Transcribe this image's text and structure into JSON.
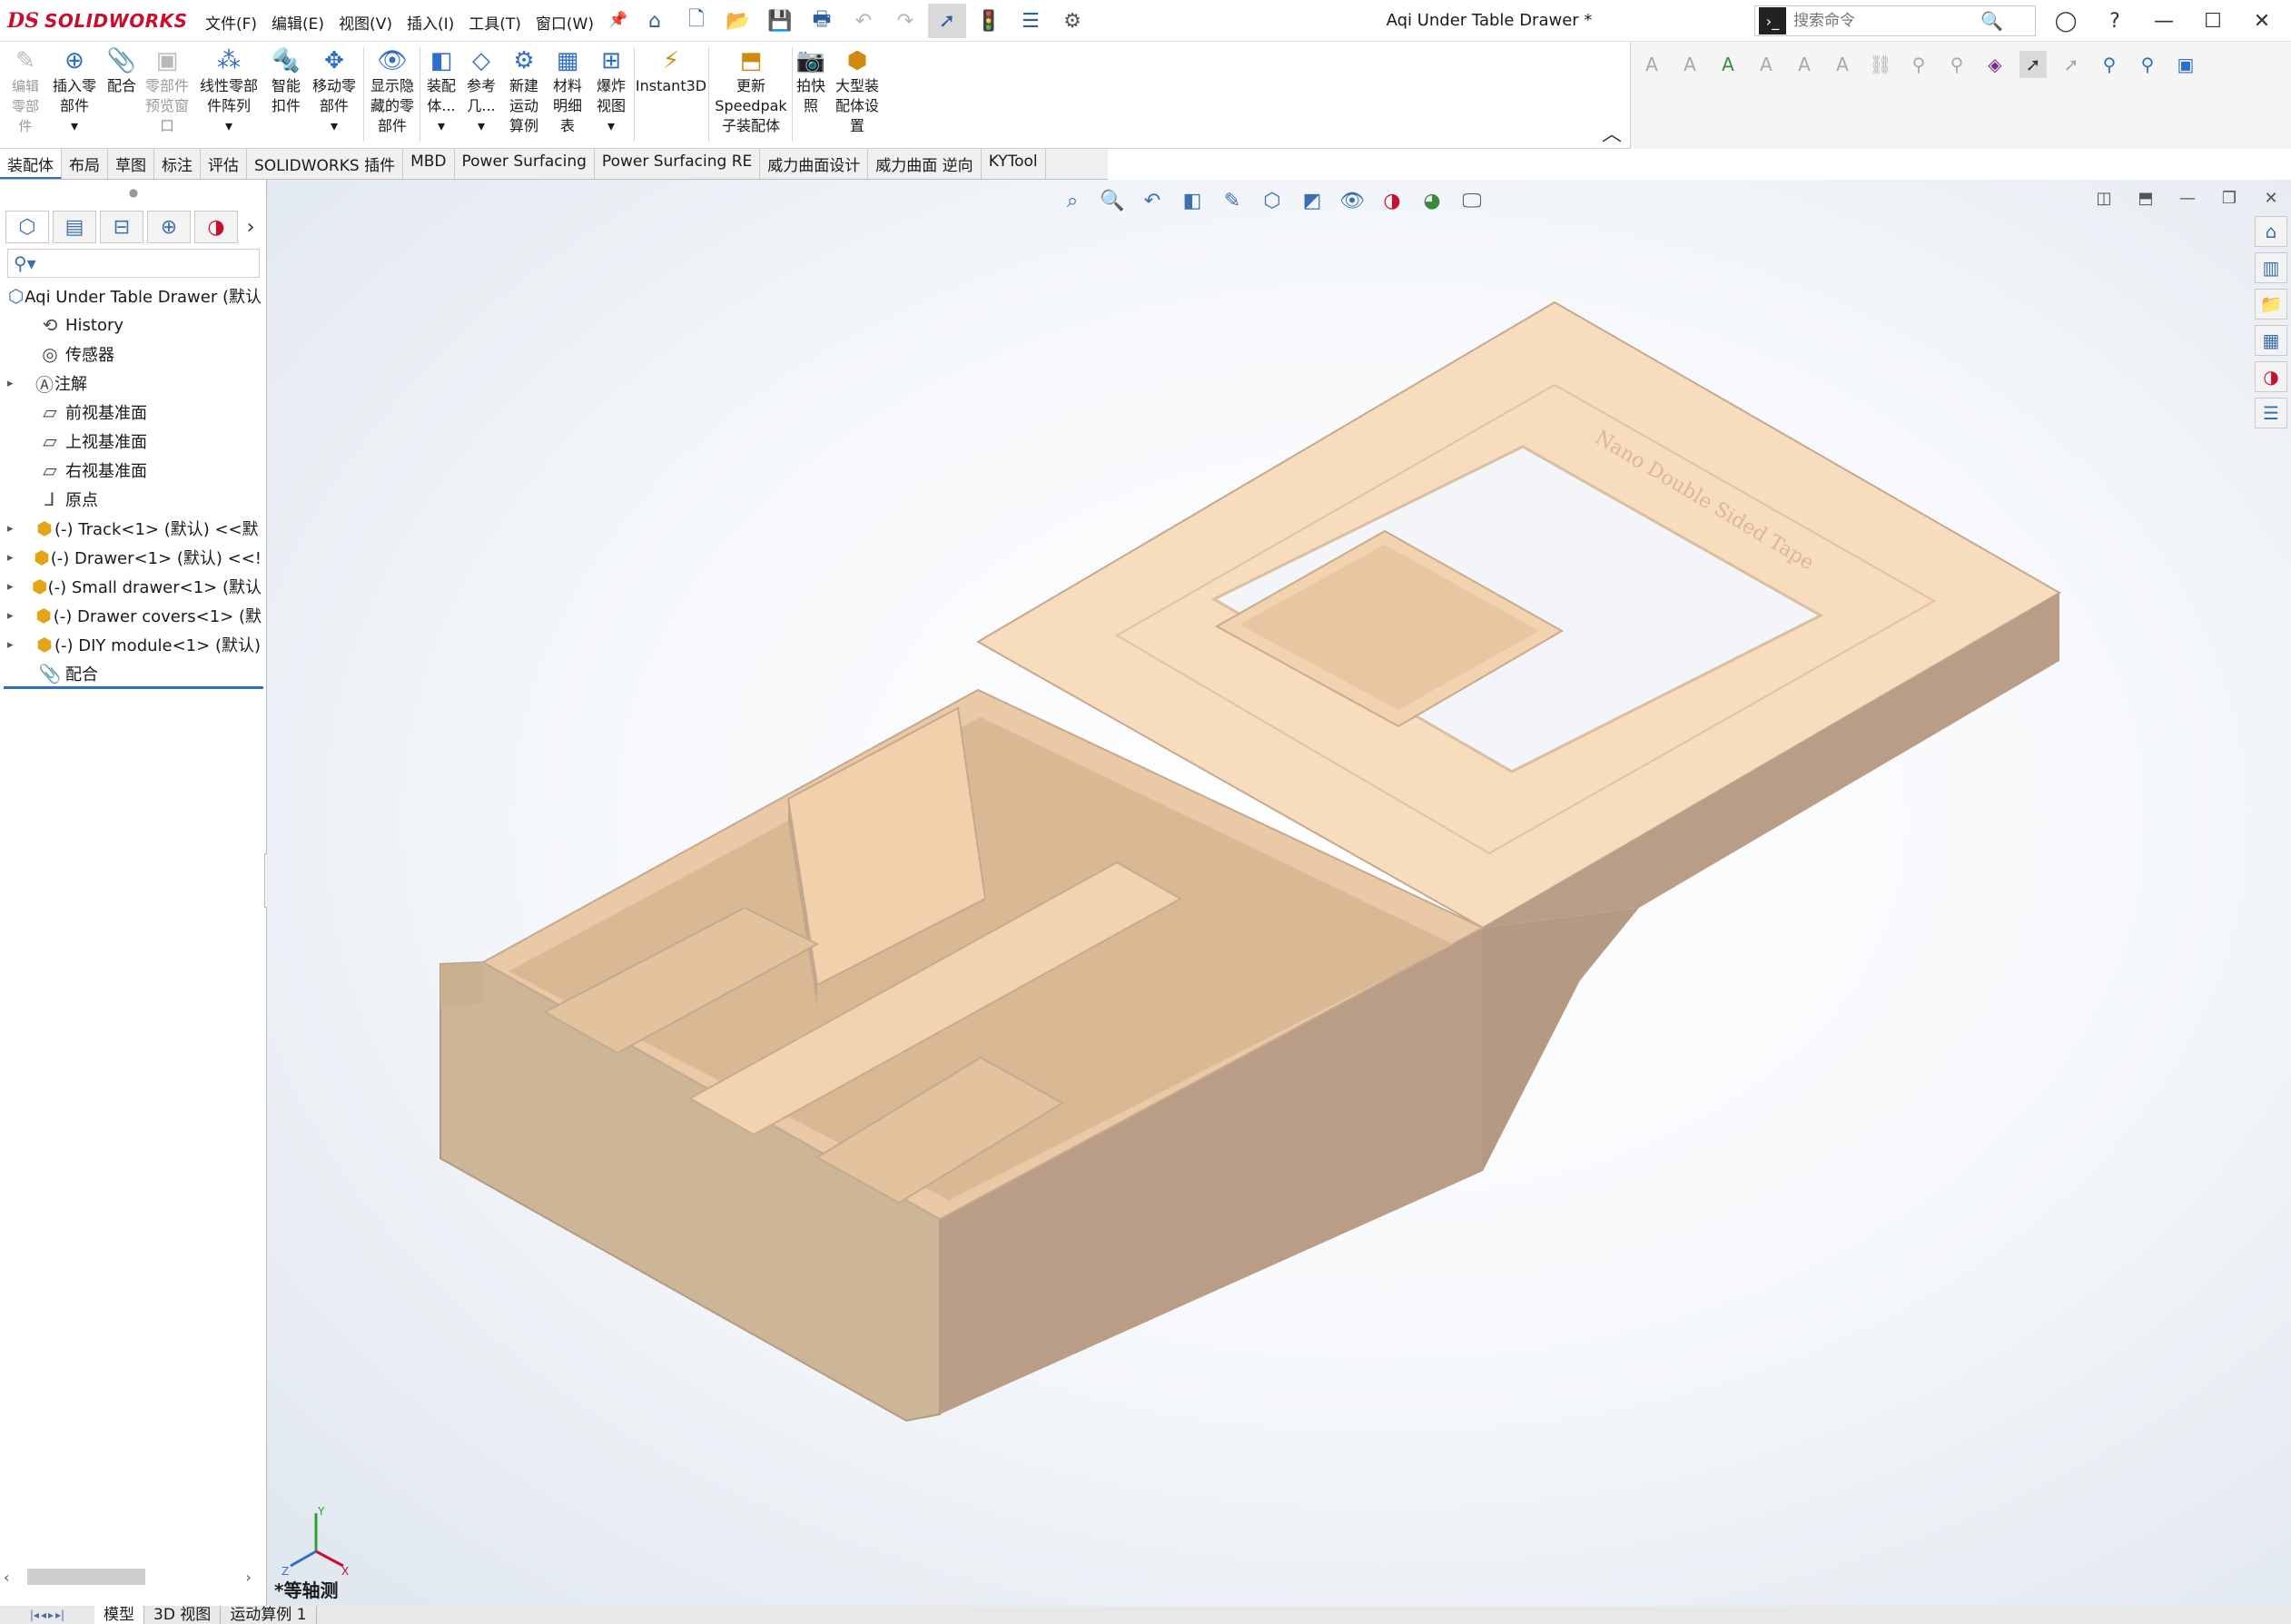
{
  "app": {
    "logo_mark": "DS",
    "logo_text": "SOLIDWORKS",
    "document_title": "Aqi Under Table Drawer *"
  },
  "menu": [
    "文件(F)",
    "编辑(E)",
    "视图(V)",
    "插入(I)",
    "工具(T)",
    "窗口(W)"
  ],
  "search": {
    "placeholder": "搜索命令"
  },
  "ribbon": {
    "buttons": [
      {
        "name": "edit-component",
        "label": "编辑\n零部\n件",
        "icon": "edit-component-icon",
        "disabled": true
      },
      {
        "name": "insert-components",
        "label": "插入零\n部件",
        "icon": "insert-component-icon"
      },
      {
        "name": "mate",
        "label": "配合",
        "icon": "mate-icon"
      },
      {
        "name": "component-preview",
        "label": "零部件\n预览窗\n口",
        "icon": "preview-window-icon",
        "disabled": true
      },
      {
        "name": "linear-pattern",
        "label": "线性零部\n件阵列",
        "icon": "linear-pattern-icon"
      },
      {
        "name": "smart-fasteners",
        "label": "智能\n扣件",
        "icon": "smart-fastener-icon"
      },
      {
        "name": "move-component",
        "label": "移动零\n部件",
        "icon": "move-component-icon"
      },
      {
        "name": "show-hidden",
        "label": "显示隐\n藏的零\n部件",
        "icon": "show-hidden-icon"
      },
      {
        "name": "assembly-features",
        "label": "装配\n体...",
        "icon": "assembly-feature-icon"
      },
      {
        "name": "reference-geometry",
        "label": "参考\n几...",
        "icon": "reference-geometry-icon"
      },
      {
        "name": "new-motion-study",
        "label": "新建\n运动\n算例",
        "icon": "motion-study-icon"
      },
      {
        "name": "bill-of-materials",
        "label": "材料\n明细\n表",
        "icon": "bom-icon"
      },
      {
        "name": "exploded-view",
        "label": "爆炸\n视图",
        "icon": "exploded-view-icon"
      },
      {
        "name": "instant3d",
        "label": "Instant3D",
        "icon": "instant3d-icon"
      },
      {
        "name": "update-speedpak",
        "label": "更新\nSpeedpak\n子装配体",
        "icon": "speedpak-icon"
      },
      {
        "name": "take-snapshot",
        "label": "拍快\n照",
        "icon": "camera-icon"
      },
      {
        "name": "large-assembly-settings",
        "label": "大型装\n配体设\n置",
        "icon": "large-assembly-icon"
      }
    ]
  },
  "tabs": [
    "装配体",
    "布局",
    "草图",
    "标注",
    "评估",
    "SOLIDWORKS 插件",
    "MBD",
    "Power Surfacing",
    "Power Surfacing RE",
    "威力曲面设计",
    "威力曲面 逆向",
    "KYTool"
  ],
  "active_tab": "装配体",
  "tree": {
    "root": "Aqi Under Table Drawer (默认",
    "items": [
      {
        "label": "History",
        "icon": "history-icon",
        "expandable": false
      },
      {
        "label": "传感器",
        "icon": "sensor-icon",
        "expandable": false
      },
      {
        "label": "注解",
        "icon": "annotation-icon",
        "expandable": true
      },
      {
        "label": "前视基准面",
        "icon": "plane-icon",
        "expandable": false
      },
      {
        "label": "上视基准面",
        "icon": "plane-icon",
        "expandable": false
      },
      {
        "label": "右视基准面",
        "icon": "plane-icon",
        "expandable": false
      },
      {
        "label": "原点",
        "icon": "origin-icon",
        "expandable": false
      },
      {
        "label": "(-) Track<1> (默认) <<默",
        "icon": "part-icon",
        "expandable": true
      },
      {
        "label": "(-) Drawer<1> (默认) <<!",
        "icon": "part-icon",
        "expandable": true
      },
      {
        "label": "(-) Small drawer<1> (默认",
        "icon": "part-icon",
        "expandable": true
      },
      {
        "label": "(-) Drawer covers<1> (默",
        "icon": "part-icon",
        "expandable": true
      },
      {
        "label": "(-) DIY module<1> (默认)",
        "icon": "part-icon",
        "expandable": true
      },
      {
        "label": "配合",
        "icon": "mates-folder-icon",
        "expandable": false
      }
    ]
  },
  "viewport": {
    "view_name": "*等轴测",
    "engraved_text": "Nano Double Sided Tape",
    "triad_labels": {
      "x": "X",
      "y": "Y",
      "z": "Z"
    }
  },
  "status_tabs": [
    "模型",
    "3D 视图",
    "运动算例 1"
  ],
  "active_status_tab": "模型",
  "colors": {
    "accent": "#2f6ec8",
    "brand": "#c8102e",
    "model_top": "#f7dcbd",
    "model_side": "#b99d87",
    "model_front": "#cdb698"
  }
}
